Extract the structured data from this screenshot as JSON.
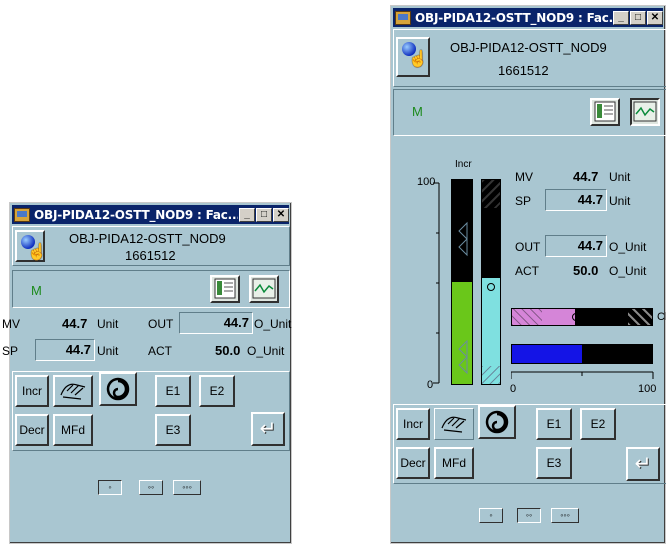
{
  "small": {
    "title": "OBJ-PIDA12-OSTT_NOD9 : Fac...",
    "tag": "OBJ-PIDA12-OSTT_NOD9",
    "id": "1661512",
    "mode": "M",
    "mv_label": "MV",
    "mv_value": "44.7",
    "mv_unit": "Unit",
    "sp_label": "SP",
    "sp_value": "44.7",
    "sp_unit": "Unit",
    "out_label": "OUT",
    "out_value": "44.7",
    "out_unit": "O_Unit",
    "act_label": "ACT",
    "act_value": "50.0",
    "act_unit": "O_Unit",
    "buttons": {
      "incr": "Incr",
      "decr": "Decr",
      "mfd": "MFd",
      "e1": "E1",
      "e2": "E2",
      "e3": "E3"
    }
  },
  "large": {
    "title": "OBJ-PIDA12-OSTT_NOD9 : Fac...",
    "tag": "OBJ-PIDA12-OSTT_NOD9",
    "id": "1661512",
    "mode": "M",
    "scale_top": "100",
    "scale_bottom": "0",
    "incr_tag": "Incr",
    "mv_label": "MV",
    "mv_value": "44.7",
    "mv_unit": "Unit",
    "sp_label": "SP",
    "sp_value": "44.7",
    "sp_unit": "Unit",
    "out_label": "OUT",
    "out_value": "44.7",
    "out_unit": "O_Unit",
    "act_label": "ACT",
    "act_value": "50.0",
    "act_unit": "O_Unit",
    "hbar_min": "0",
    "hbar_max": "100",
    "cl_tag": "Cl",
    "buttons": {
      "incr": "Incr",
      "decr": "Decr",
      "mfd": "MFd",
      "e1": "E1",
      "e2": "E2",
      "e3": "E3"
    },
    "levels": {
      "green_fill": 0.5,
      "cyan_fill": 0.52,
      "pink_fill": 0.45,
      "blue_fill": 0.5
    }
  },
  "icons": {
    "close": "✕",
    "minimize": "_",
    "maximize": "□",
    "enter": "↵"
  },
  "colors": {
    "title_bg": "#0a246a",
    "panel_bg": "#a9c6d1",
    "mode_green": "#1c8a1c"
  }
}
